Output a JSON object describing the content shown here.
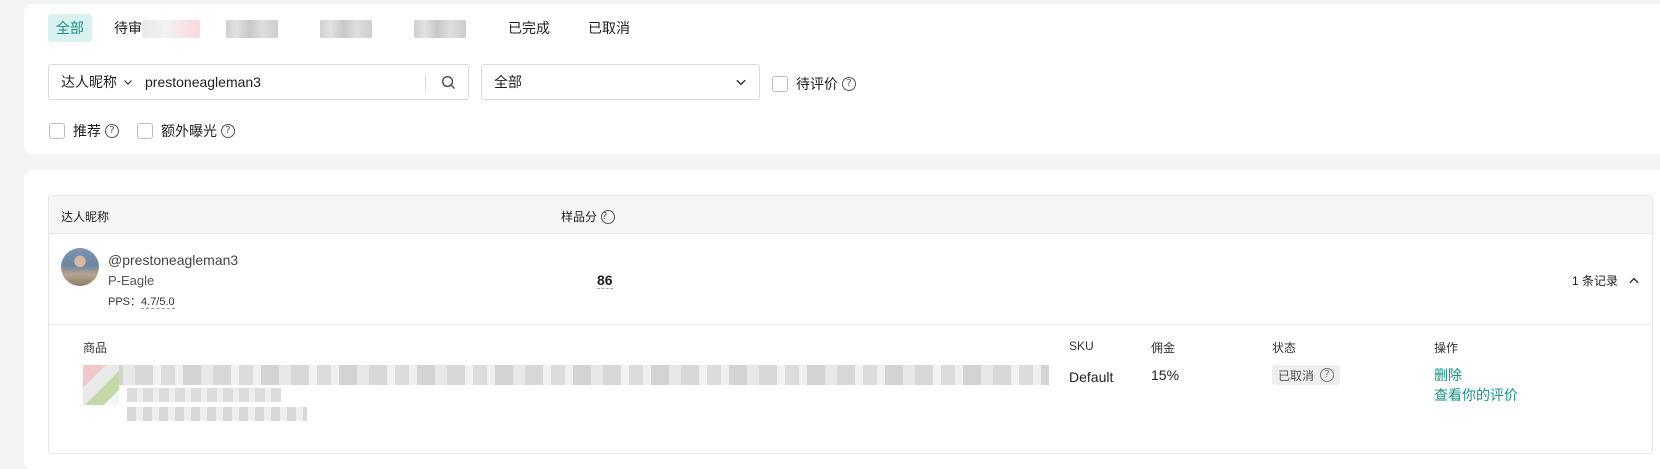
{
  "tabs": [
    {
      "label": "全部",
      "active": true
    },
    {
      "label": "待审"
    },
    {
      "label": ""
    },
    {
      "label": ""
    },
    {
      "label": ""
    },
    {
      "label": "已完成"
    },
    {
      "label": "已取消"
    }
  ],
  "search": {
    "type_label": "达人昵称",
    "value": "prestoneagleman3"
  },
  "status_select": {
    "value": "全部"
  },
  "filters": {
    "pending_review": "待评价",
    "recommend": "推荐",
    "extra_exposure": "额外曝光"
  },
  "table": {
    "headers": {
      "creator": "达人昵称",
      "sample_score": "样品分"
    },
    "row": {
      "handle": "@prestoneagleman3",
      "nickname": "P-Eagle",
      "pps_label": "PPS：",
      "pps_value": "4.7/5.0",
      "score": "86",
      "records": "1 条记录"
    },
    "sub_headers": {
      "product": "商品",
      "sku": "SKU",
      "commission": "佣金",
      "status": "状态",
      "action": "操作"
    },
    "sub_row": {
      "sku": "Default",
      "commission": "15%",
      "status": "已取消",
      "action_delete": "删除",
      "action_view_review": "查看你的评价"
    }
  },
  "colors": {
    "accent": "#12948a",
    "tab_active_bg": "#d9f1ef"
  }
}
